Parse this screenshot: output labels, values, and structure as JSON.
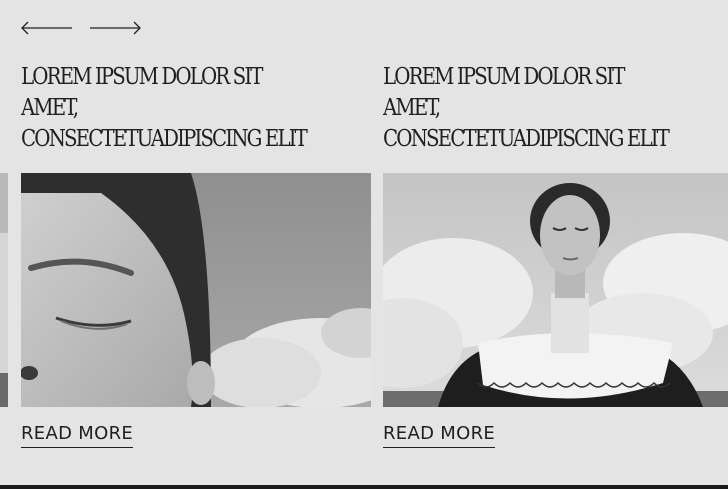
{
  "carousel": {
    "prev_label": "Previous",
    "next_label": "Next",
    "cards": [
      {
        "title": "LOREM IPSUM DOLOR SIT AMET,\nCONSECTETUADIPISCING ELIT",
        "image_alt": "Close-up black and white portrait of a woman with closed eyes against a cloudy sky",
        "link_label": "READ MORE"
      },
      {
        "title": "LOREM IPSUM DOLOR SIT AMET,\nCONSECTETUADIPISCING ELIT",
        "image_alt": "Black and white portrait of a woman with closed eyes wearing a white scalloped collar",
        "link_label": "READ MORE"
      }
    ]
  },
  "icons": {
    "prev": "arrow-left-icon",
    "next": "arrow-right-icon"
  },
  "colors": {
    "background": "#e4e4e4",
    "text": "#1f1f1f"
  }
}
